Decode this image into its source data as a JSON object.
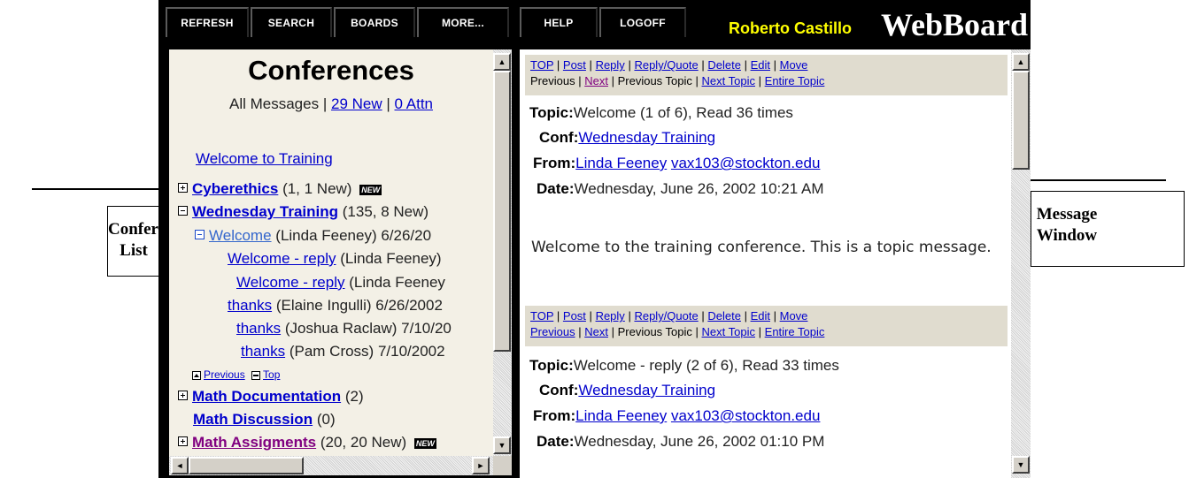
{
  "callouts": {
    "conference_list": "Conference List",
    "message_window": "Message Window"
  },
  "toolbar": {
    "refresh": "REFRESH",
    "search": "SEARCH",
    "boards": "BOARDS",
    "more": "MORE...",
    "help": "HELP",
    "logoff": "LOGOFF",
    "user_name": "Roberto Castillo",
    "brand": "WebBoard"
  },
  "conferences": {
    "title": "Conferences",
    "all_messages": "All Messages",
    "sep": "|",
    "new_count": "29 New",
    "attn_count": "0 Attn",
    "welcome_link": "Welcome to Training",
    "new_badge": "NEW",
    "cyberethics": {
      "name": "Cyberethics",
      "count": "(1, 1 New)"
    },
    "wednesday": {
      "name": "Wednesday Training",
      "count": "(135, 8 New)"
    },
    "thread": [
      {
        "title": "Welcome",
        "meta": "(Linda Feeney) 6/26/20"
      },
      {
        "title": "Welcome - reply",
        "meta": "(Linda Feeney)"
      },
      {
        "title": "Welcome - reply",
        "meta": "(Linda Feeney"
      },
      {
        "title": "thanks",
        "meta": "(Elaine Ingulli) 6/26/2002"
      },
      {
        "title": "thanks",
        "meta": "(Joshua Raclaw) 7/10/20"
      },
      {
        "title": "thanks",
        "meta": "(Pam Cross) 7/10/2002"
      }
    ],
    "nav_previous": "Previous",
    "nav_top": "Top",
    "math_doc": {
      "name": "Math Documentation",
      "count": "(2)"
    },
    "math_disc": {
      "name": "Math Discussion",
      "count": "(0)"
    },
    "math_assign": {
      "name": "Math Assigments",
      "count": "(20, 20 New)"
    }
  },
  "actions": {
    "top": "TOP",
    "post": "Post",
    "reply": "Reply",
    "reply_quote": "Reply/Quote",
    "delete": "Delete",
    "edit": "Edit",
    "move": "Move",
    "previous": "Previous",
    "next": "Next",
    "previous_topic": "Previous Topic",
    "next_topic": "Next Topic",
    "entire_topic": "Entire Topic",
    "sep": "|"
  },
  "labels": {
    "topic": "Topic:",
    "conf": "Conf:",
    "from": "From:",
    "date": "Date:"
  },
  "messages": [
    {
      "topic": "Welcome (1 of 6), Read 36 times",
      "conf": "Wednesday Training",
      "from_name": "Linda Feeney",
      "from_email": "vax103@stockton.edu",
      "date": "Wednesday, June 26, 2002 10:21 AM",
      "body": "Welcome to the training conference. This is a topic message."
    },
    {
      "topic": "Welcome - reply (2 of 6), Read 33 times",
      "conf": "Wednesday Training",
      "from_name": "Linda Feeney",
      "from_email": "vax103@stockton.edu",
      "date": "Wednesday, June 26, 2002 01:10 PM"
    }
  ],
  "scroll_icons": {
    "up": "▲",
    "down": "▼",
    "left": "◄",
    "right": "►"
  }
}
